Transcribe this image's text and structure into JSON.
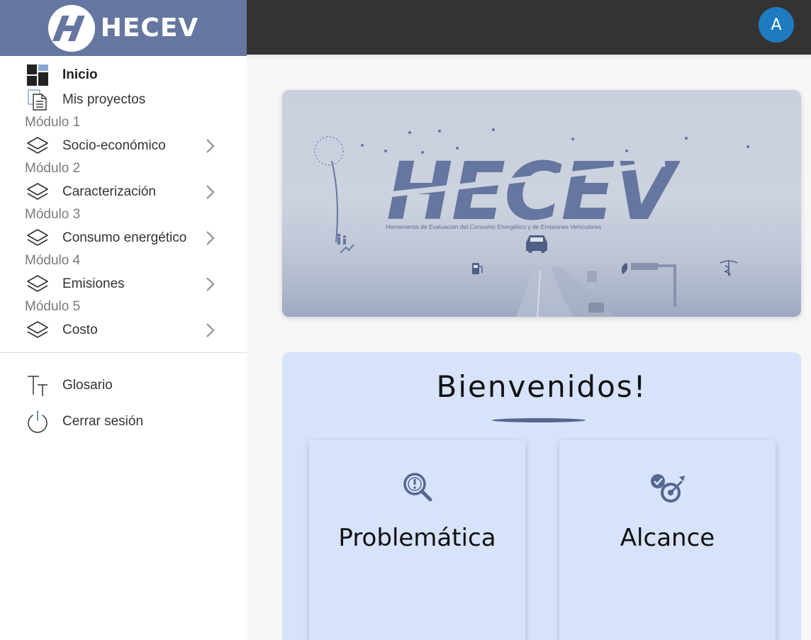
{
  "brand": {
    "name": "HECEV"
  },
  "colors": {
    "brand_bar": "#6577a0",
    "topbar": "#333333",
    "avatar": "#1f7bc0",
    "welcome_bg": "#d6e3fb",
    "accent": "#55668f"
  },
  "sidebar": {
    "items": [
      {
        "label": "Inicio",
        "icon": "dashboard-icon"
      },
      {
        "label": "Mis proyectos",
        "icon": "document-icon"
      }
    ],
    "modules": [
      {
        "heading": "Módulo 1",
        "label": "Socio-económico",
        "icon": "layers-icon"
      },
      {
        "heading": "Módulo 2",
        "label": "Caracterización",
        "icon": "layers-icon"
      },
      {
        "heading": "Módulo 3",
        "label": "Consumo energético",
        "icon": "layers-icon"
      },
      {
        "heading": "Módulo 4",
        "label": "Emisiones",
        "icon": "layers-icon"
      },
      {
        "heading": "Módulo 5",
        "label": "Costo",
        "icon": "layers-icon"
      }
    ],
    "bottom": [
      {
        "label": "Glosario",
        "icon": "text-size-icon"
      },
      {
        "label": "Cerrar sesión",
        "icon": "power-icon"
      }
    ]
  },
  "topbar": {
    "avatar_initial": "A"
  },
  "banner": {
    "title": "HECEV",
    "subtitle": "Herramienta de Evaluación del Consumo Energético y de Emisiones Vehiculares"
  },
  "welcome": {
    "title": "Bienvenidos!",
    "cards": [
      {
        "label": "Problemática",
        "icon": "magnifier-alert-icon"
      },
      {
        "label": "Alcance",
        "icon": "target-check-icon"
      }
    ]
  }
}
